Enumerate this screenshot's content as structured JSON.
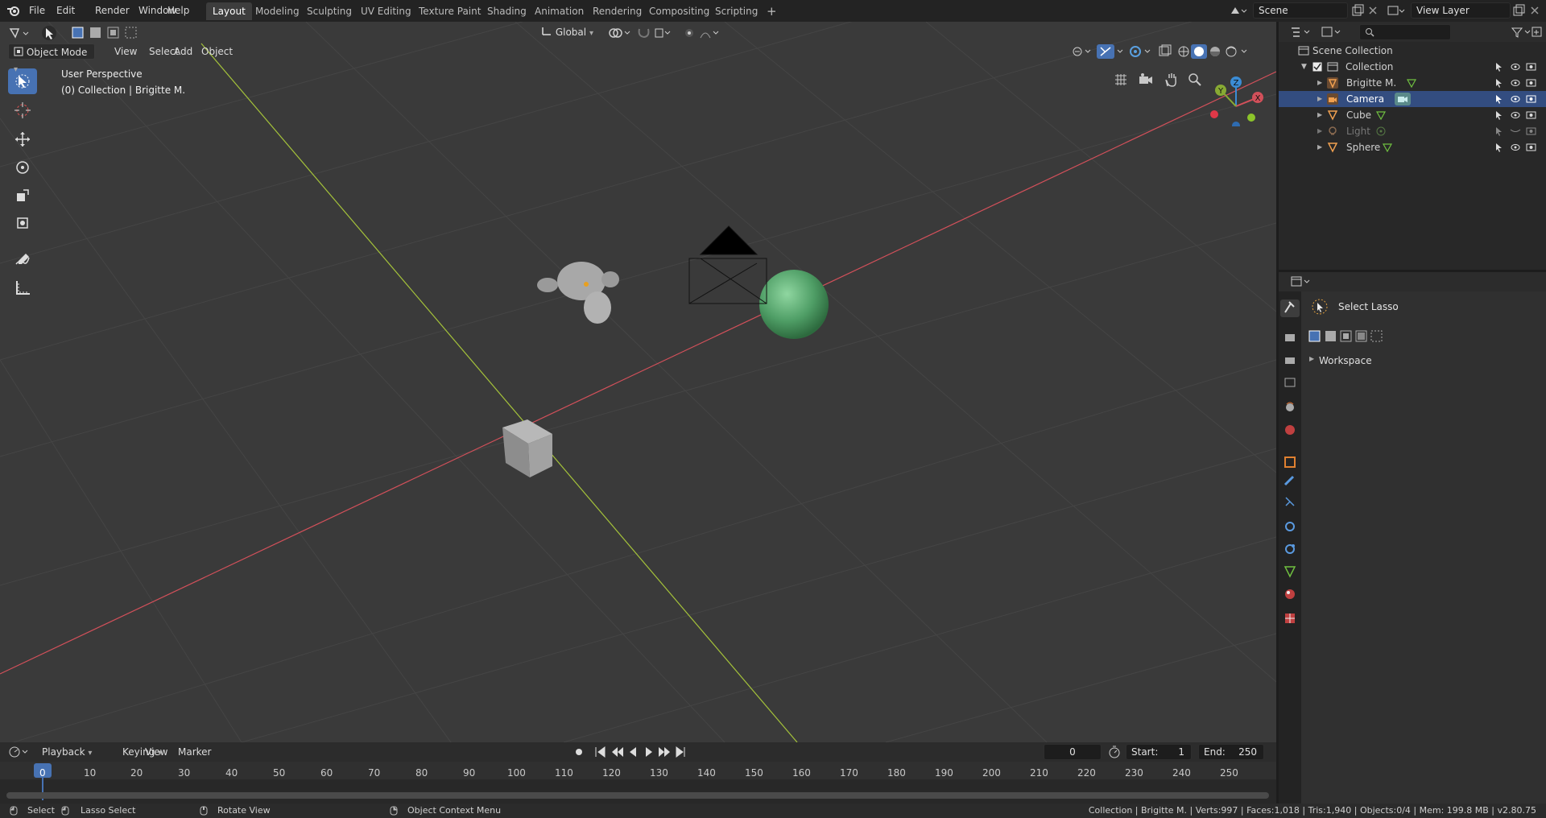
{
  "menu": [
    "File",
    "Edit",
    "Render",
    "Window",
    "Help"
  ],
  "workspace_tabs": [
    {
      "label": "Layout",
      "active": true
    },
    {
      "label": "Modeling"
    },
    {
      "label": "Sculpting"
    },
    {
      "label": "UV Editing"
    },
    {
      "label": "Texture Paint"
    },
    {
      "label": "Shading"
    },
    {
      "label": "Animation"
    },
    {
      "label": "Rendering"
    },
    {
      "label": "Compositing"
    },
    {
      "label": "Scripting"
    }
  ],
  "add_workspace": "+",
  "scene": {
    "name": "Scene",
    "view_layer": "View Layer"
  },
  "viewport": {
    "mode": "Object Mode",
    "menus": [
      "View",
      "Select",
      "Add",
      "Object"
    ],
    "transform_orientation": "Global",
    "overlay_title": "User Perspective",
    "overlay_subtitle": "(0) Collection | Brigitte M.",
    "gizmo_axes": {
      "x": "X",
      "y": "Y",
      "z": "Z"
    },
    "colors": {
      "background": "#3a3a3a",
      "x_axis": "#d2505a",
      "y_axis": "#a4c23a",
      "selected": "#4772b3"
    }
  },
  "outliner": {
    "search_placeholder": "",
    "scene_collection": "Scene Collection",
    "collection": "Collection",
    "items": [
      {
        "label": "Brigitte M.",
        "icon": "mesh-icon"
      },
      {
        "label": "Camera",
        "icon": "camera-icon",
        "selected": true
      },
      {
        "label": "Cube",
        "icon": "mesh-icon"
      },
      {
        "label": "Light",
        "icon": "light-icon",
        "dimmed": true
      },
      {
        "label": "Sphere",
        "icon": "mesh-icon"
      }
    ]
  },
  "properties": {
    "tool_name": "Select Lasso",
    "panel": "Workspace"
  },
  "timeline": {
    "menus": [
      "Playback",
      "Keying",
      "View",
      "Marker"
    ],
    "current_frame": "0",
    "start_label": "Start:",
    "start": "1",
    "end_label": "End:",
    "end": "250",
    "ruler": [
      "0",
      "10",
      "20",
      "30",
      "40",
      "50",
      "60",
      "70",
      "80",
      "90",
      "100",
      "110",
      "120",
      "130",
      "140",
      "150",
      "160",
      "170",
      "180",
      "190",
      "200",
      "210",
      "220",
      "230",
      "240",
      "250"
    ]
  },
  "statusbar": {
    "select": "Select",
    "lasso": "Lasso Select",
    "rotate": "Rotate View",
    "context": "Object Context Menu",
    "stats": "Collection | Brigitte M. | Verts:997 | Faces:1,018 | Tris:1,940 | Objects:0/4 | Mem: 199.8 MB | v2.80.75"
  }
}
